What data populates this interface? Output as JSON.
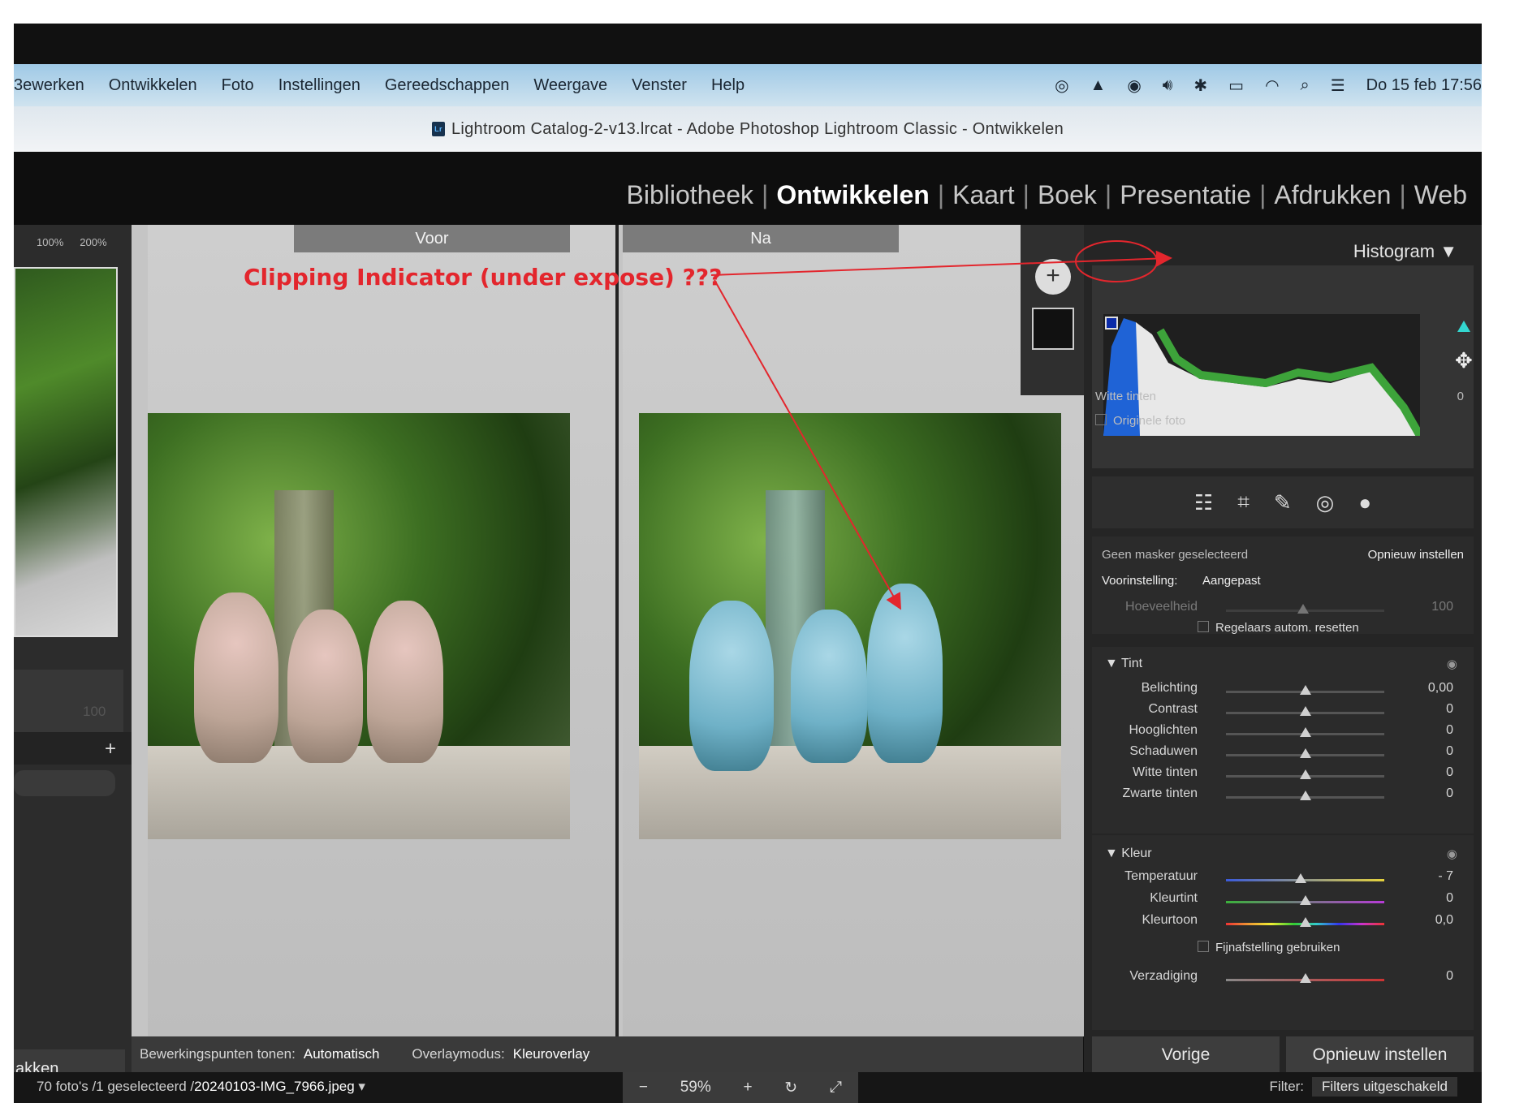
{
  "menubar": {
    "items": [
      "3ewerken",
      "Ontwikkelen",
      "Foto",
      "Instellingen",
      "Gereedschappen",
      "Weergave",
      "Venster",
      "Help"
    ],
    "clock": "Do 15 feb  17:56"
  },
  "window_title": "Lightroom Catalog-2-v13.lrcat - Adobe Photoshop Lightroom Classic - Ontwikkelen",
  "modules": {
    "items": [
      "Bibliotheek",
      "Ontwikkelen",
      "Kaart",
      "Boek",
      "Presentatie",
      "Afdrukken",
      "Web"
    ],
    "active": "Ontwikkelen"
  },
  "left_panel": {
    "zoom_100": "100%",
    "zoom_200": "200%",
    "value": "100",
    "add": "+",
    "bottom_button": "akken"
  },
  "compare": {
    "before_label": "Voor",
    "after_label": "Na"
  },
  "toolbar": {
    "edit_points_label": "Bewerkingspunten tonen:",
    "edit_points_value": "Automatisch",
    "overlay_label": "Overlaymodus:",
    "overlay_value": "Kleuroverlay"
  },
  "annotation": {
    "text": "Clipping Indicator (under expose) ???",
    "color": "#e3262d"
  },
  "histogram": {
    "title": "Histogram",
    "readout_label": "Witte tinten",
    "readout_value": "0",
    "original_photo": "Originele foto"
  },
  "mask": {
    "none_selected": "Geen masker geselecteerd",
    "reset": "Opnieuw instellen",
    "preset_label": "Voorinstelling:",
    "preset_value": "Aangepast",
    "amount_label": "Hoeveelheid",
    "amount_value": "100",
    "auto_reset": "Regelaars autom. resetten"
  },
  "tint": {
    "title": "Tint",
    "sliders": [
      {
        "label": "Belichting",
        "value": "0,00",
        "pos": 0.5
      },
      {
        "label": "Contrast",
        "value": "0",
        "pos": 0.5
      },
      {
        "label": "Hooglichten",
        "value": "0",
        "pos": 0.5
      },
      {
        "label": "Schaduwen",
        "value": "0",
        "pos": 0.5
      },
      {
        "label": "Witte tinten",
        "value": "0",
        "pos": 0.5
      },
      {
        "label": "Zwarte tinten",
        "value": "0",
        "pos": 0.5
      }
    ]
  },
  "kleur": {
    "title": "Kleur",
    "sliders": [
      {
        "label": "Temperatuur",
        "value": "- 7",
        "pos": 0.47
      },
      {
        "label": "Kleurtint",
        "value": "0",
        "pos": 0.5
      },
      {
        "label": "Kleurtoon",
        "value": "0,0",
        "pos": 0.5
      }
    ],
    "fine_tune": "Fijnafstelling gebruiken",
    "saturation": {
      "label": "Verzadiging",
      "value": "0",
      "pos": 0.5
    }
  },
  "nav": {
    "previous": "Vorige",
    "reset": "Opnieuw instellen"
  },
  "status": {
    "count": "70 foto's /1 geselecteerd /",
    "filename": "20240103-IMG_7966.jpeg",
    "zoom": "59%",
    "filter_label": "Filter:",
    "filter_value": "Filters uitgeschakeld"
  }
}
